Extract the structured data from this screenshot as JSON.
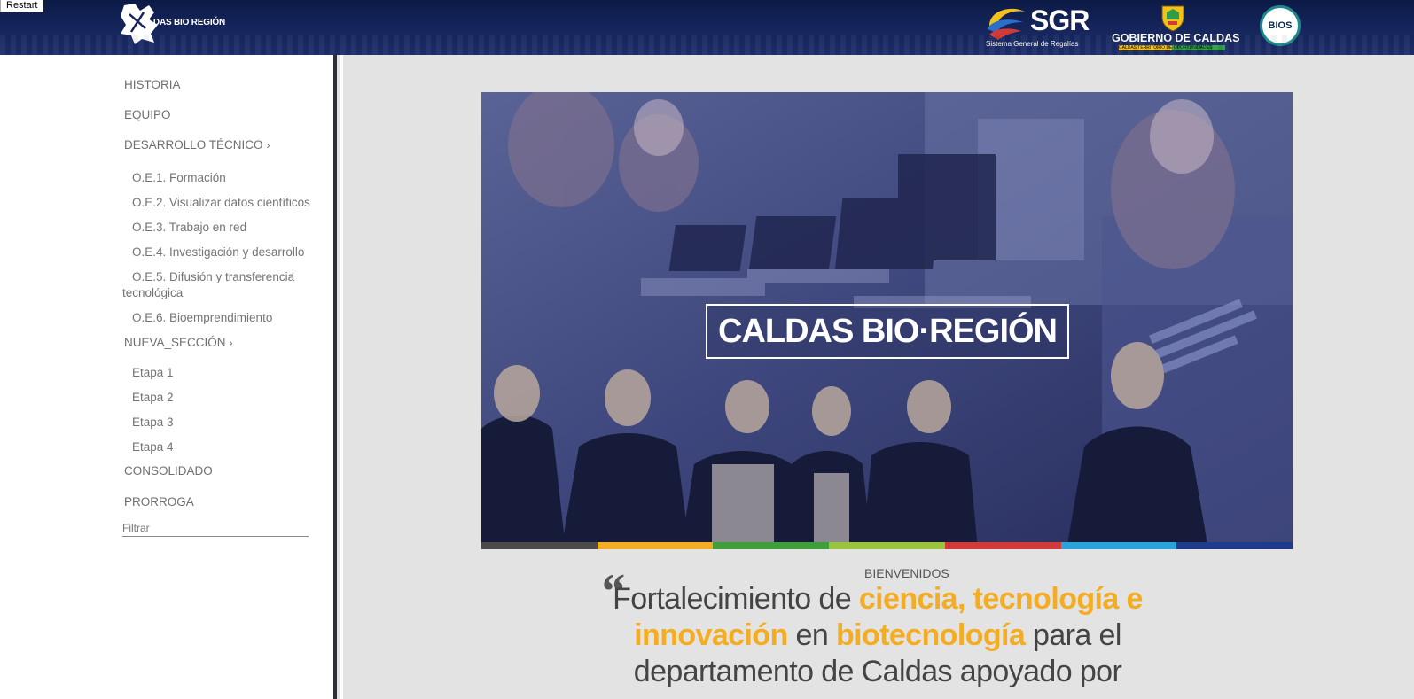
{
  "header": {
    "restart_label": "Restart",
    "brand_text": "ALDAS BIO REGIÓN",
    "sgr_word": "SGR",
    "sgr_subtitle": "Sistema General de Regalías",
    "gobierno_title": "GOBIERNO DE CALDAS",
    "gobierno_subtitle": "CALDAS TERRITORIO DE OPORTUNIDADES",
    "bios_label": "BIOS"
  },
  "sidebar": {
    "items": [
      {
        "label": "HISTORIA"
      },
      {
        "label": "EQUIPO"
      },
      {
        "label": "DESARROLLO TÉCNICO"
      },
      {
        "label": "O.E.1. Formación"
      },
      {
        "label": "O.E.2. Visualizar datos científicos"
      },
      {
        "label": "O.E.3. Trabajo en red"
      },
      {
        "label": "O.E.4. Investigación y desarrollo"
      },
      {
        "label": "O.E.5. Difusión y transferencia tecnológica"
      },
      {
        "label": "O.E.6. Bioemprendimiento"
      },
      {
        "label": "NUEVA_SECCIÓN"
      },
      {
        "label": "Etapa 1"
      },
      {
        "label": "Etapa 2"
      },
      {
        "label": "Etapa 3"
      },
      {
        "label": "Etapa 4"
      },
      {
        "label": "CONSOLIDADO"
      },
      {
        "label": "PRORROGA"
      }
    ],
    "chevron": "›",
    "filter_placeholder": "Filtrar"
  },
  "hero": {
    "title": "CALDAS BIO·REGIÓN",
    "stripe_colors": [
      "#4a4a4a",
      "#f4ac22",
      "#3f9e3a",
      "#9ac43c",
      "#d23a3a",
      "#2aa3d8",
      "#1f3b8c"
    ]
  },
  "content": {
    "welcome": "BIENVENIDOS",
    "quote_mark": "“",
    "slogan_parts": [
      "Fortalecimiento de ",
      "ciencia, tecnología e innovación",
      " en ",
      "biotecnología",
      " para el departamento de Caldas apoyado por"
    ]
  },
  "colors": {
    "header_bg": "#14245a",
    "accent": "#f4ac22",
    "sidebar_text": "#6f6f6f"
  }
}
